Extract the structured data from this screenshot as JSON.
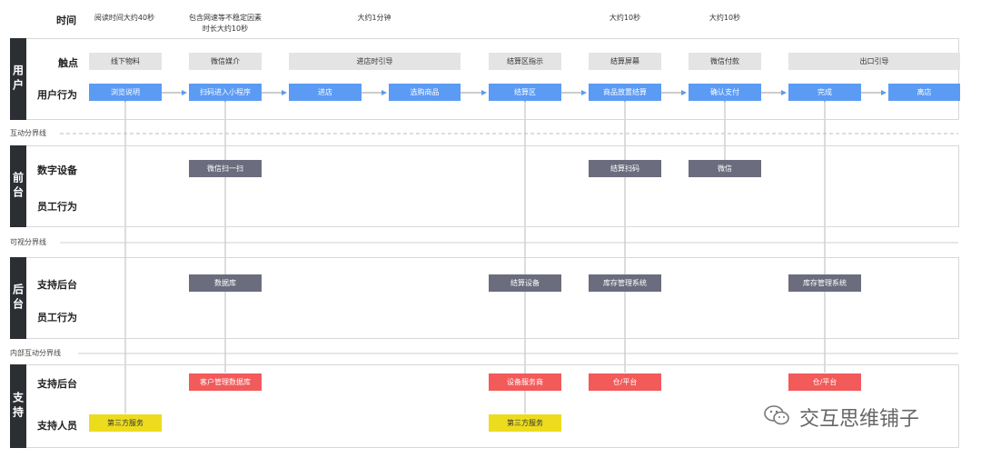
{
  "time": {
    "label": "时间",
    "cells": [
      "阅读时间大约40秒",
      "包含网速等不稳定因素\n时长大约10秒",
      "大约1分钟",
      "大约10秒",
      "大约10秒"
    ]
  },
  "sections": {
    "user": "用户",
    "front": "前台",
    "back": "后台",
    "support": "支持"
  },
  "rows": {
    "touchpoint": "触点",
    "user_action": "用户行为",
    "digital_device": "数字设备",
    "staff_action_front": "员工行为",
    "support_backend_back": "支持后台",
    "staff_action_back": "员工行为",
    "support_backend_support": "支持后台",
    "support_staff": "支持人员"
  },
  "dividers": {
    "interaction": "互动分界线",
    "visibility": "可视分界线",
    "internal": "内部互动分界线"
  },
  "touchpoints": [
    "线下物料",
    "微信媒介",
    "进店时引导",
    "结算区指示",
    "结算屏幕",
    "微信付款",
    "出口引导"
  ],
  "user_actions": [
    "浏览说明",
    "扫码进入小程序",
    "进店",
    "选购商品",
    "结算区",
    "商品放置结算",
    "确认支付",
    "完成",
    "离店"
  ],
  "digital_devices": [
    "微信扫一扫",
    "结算扫码",
    "微信"
  ],
  "back_support": [
    "数据库",
    "结算设备",
    "库存管理系统",
    "库存管理系统"
  ],
  "support_backend": [
    "客户管理数据库",
    "设备服务商",
    "仓/平台",
    "仓/平台"
  ],
  "support_staff": [
    "第三方服务",
    "第三方服务"
  ],
  "watermark": "交互思维铺子",
  "colors": {
    "user_action": "#5b9bf4",
    "device": "#6b6d7e",
    "support_red": "#f35a5a",
    "support_yellow": "#eddc1e",
    "touchpoint": "#e4e4e4",
    "side_tab": "#2b2f33"
  }
}
